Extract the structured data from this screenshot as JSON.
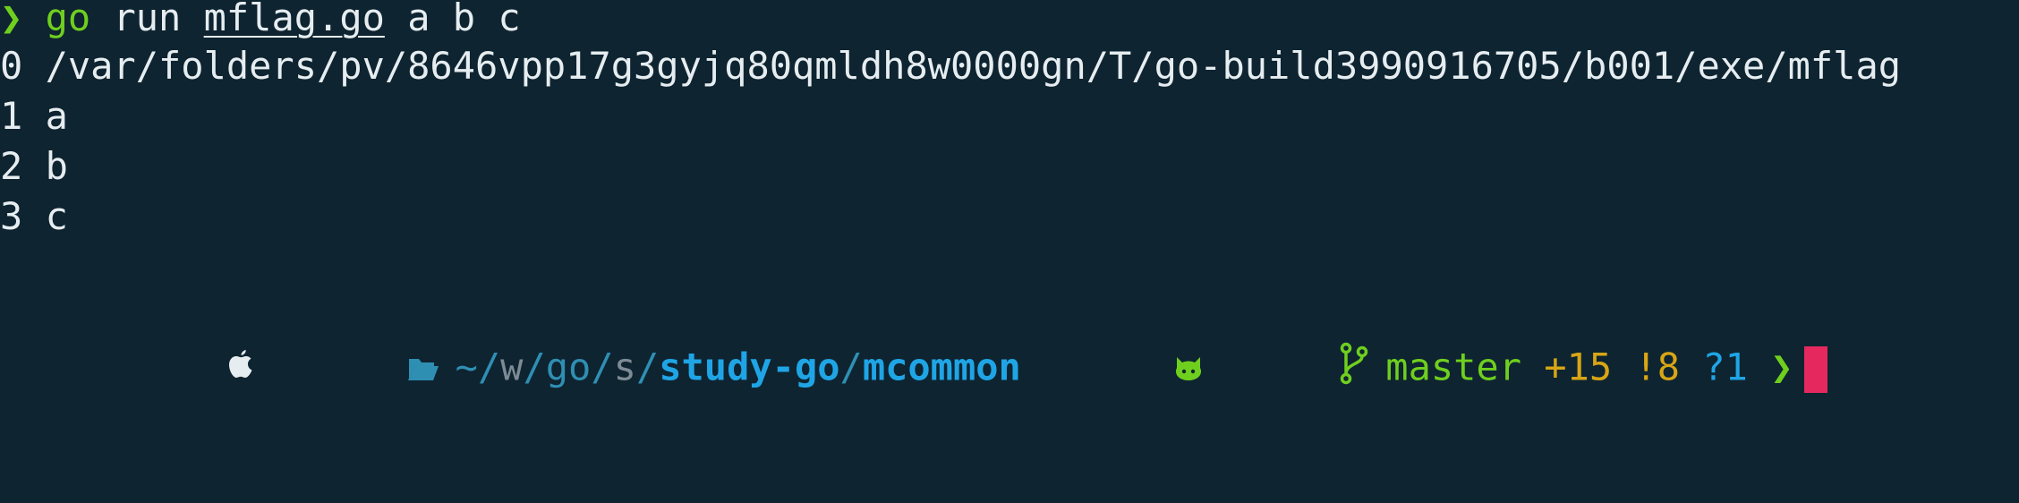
{
  "prompt_line": {
    "prompt_symbol": "❯",
    "command": "go",
    "args_before": " run ",
    "file": "mflag.go",
    "args_after": " a b c"
  },
  "output": [
    "0 /var/folders/pv/8646vpp17g3gyjq80qmldh8w0000gn/T/go-build3990916705/b001/exe/mflag",
    "1 a",
    "2 b",
    "3 c"
  ],
  "status_line": {
    "os_icon": "apple-icon",
    "folder_icon": "folder-open-icon",
    "path_tilde": "~/",
    "path_w": "w",
    "path_sep1": "/",
    "path_go": "go",
    "path_sep2": "/",
    "path_s": "s",
    "path_sep3": "/",
    "path_study": "study-go",
    "path_sep4": "/",
    "path_current": "mcommon",
    "vcs_icon": "github-icon",
    "branch_icon": "git-branch-icon",
    "branch": "master",
    "staged": "+15",
    "modified": "!8",
    "untracked": "?1",
    "prompt_symbol": "❯"
  },
  "colors": {
    "background": "#0e2431",
    "text": "#e6edf0",
    "green": "#6fcf1e",
    "blue": "#1fa5e6",
    "yellow": "#d8a515",
    "cursor": "#e5295f"
  }
}
